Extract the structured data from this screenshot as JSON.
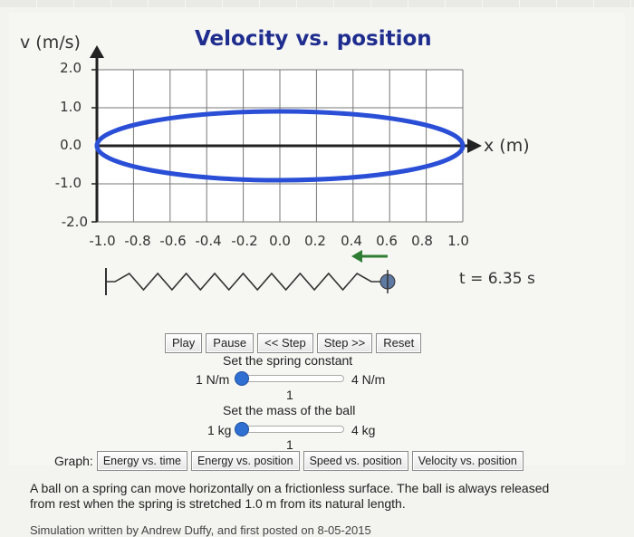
{
  "graph": {
    "title": "Velocity vs. position",
    "y_axis_label": "v (m/s)",
    "x_axis_label": "x (m)",
    "y_ticks": [
      "2.0",
      "1.0",
      "0.0",
      "-1.0",
      "-2.0"
    ],
    "x_ticks": [
      "-1.0",
      "-0.8",
      "-0.6",
      "-0.4",
      "-0.2",
      "0.0",
      "0.2",
      "0.4",
      "0.6",
      "0.8",
      "1.0"
    ],
    "curve_color": "#2a4fd6"
  },
  "simulation": {
    "time_readout": "t = 6.35 s",
    "ball_position_m": 0.8,
    "direction": "left"
  },
  "controls": {
    "play": "Play",
    "pause": "Pause",
    "step_back": "<< Step",
    "step_forward": "Step >>",
    "reset": "Reset"
  },
  "spring_slider": {
    "title": "Set the spring constant",
    "min_label": "1 N/m",
    "max_label": "4 N/m",
    "value": "1"
  },
  "mass_slider": {
    "title": "Set the mass of the ball",
    "min_label": "1 kg",
    "max_label": "4 kg",
    "value": "1"
  },
  "graph_selector": {
    "label": "Graph:",
    "options": [
      "Energy vs. time",
      "Energy vs. position",
      "Speed vs. position",
      "Velocity vs. position"
    ]
  },
  "description": "A ball on a spring can move horizontally on a frictionless surface. The ball is always released from rest when the spring is stretched 1.0 m from its natural length.",
  "credit": "Simulation written by Andrew Duffy, and first posted on 8-05-2015"
}
